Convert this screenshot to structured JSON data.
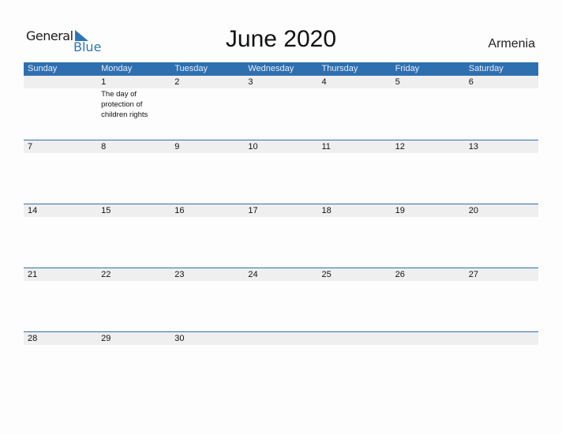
{
  "logo": {
    "general": "General",
    "blue": "Blue"
  },
  "title": "June 2020",
  "country": "Armenia",
  "colors": {
    "accent": "#2e6fb0",
    "row_shade": "#efefef"
  },
  "weekdays": [
    "Sunday",
    "Monday",
    "Tuesday",
    "Wednesday",
    "Thursday",
    "Friday",
    "Saturday"
  ],
  "weeks": [
    [
      {
        "day": ""
      },
      {
        "day": "1",
        "event": "The day of protection of children rights"
      },
      {
        "day": "2"
      },
      {
        "day": "3"
      },
      {
        "day": "4"
      },
      {
        "day": "5"
      },
      {
        "day": "6"
      }
    ],
    [
      {
        "day": "7"
      },
      {
        "day": "8"
      },
      {
        "day": "9"
      },
      {
        "day": "10"
      },
      {
        "day": "11"
      },
      {
        "day": "12"
      },
      {
        "day": "13"
      }
    ],
    [
      {
        "day": "14"
      },
      {
        "day": "15"
      },
      {
        "day": "16"
      },
      {
        "day": "17"
      },
      {
        "day": "18"
      },
      {
        "day": "19"
      },
      {
        "day": "20"
      }
    ],
    [
      {
        "day": "21"
      },
      {
        "day": "22"
      },
      {
        "day": "23"
      },
      {
        "day": "24"
      },
      {
        "day": "25"
      },
      {
        "day": "26"
      },
      {
        "day": "27"
      }
    ],
    [
      {
        "day": "28"
      },
      {
        "day": "29"
      },
      {
        "day": "30"
      },
      {
        "day": ""
      },
      {
        "day": ""
      },
      {
        "day": ""
      },
      {
        "day": ""
      }
    ]
  ]
}
